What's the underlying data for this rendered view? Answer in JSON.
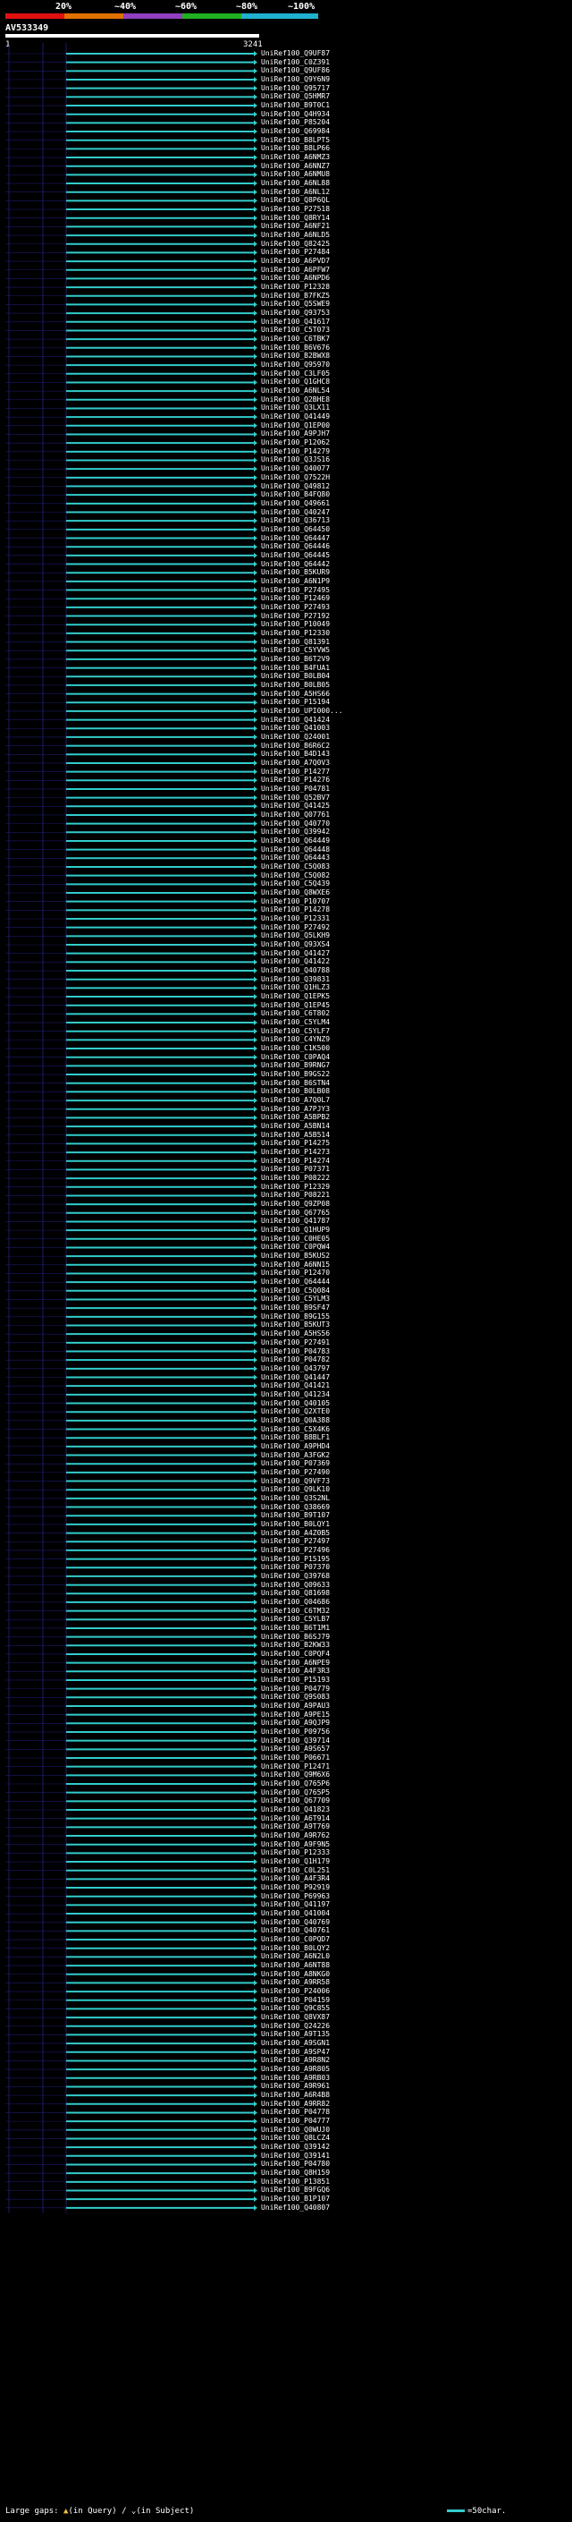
{
  "header": {
    "pct_labels": [
      "20%",
      "~40%",
      "~60%",
      "~80%",
      "~100%"
    ],
    "bar_colors": [
      "#e01010",
      "#e07000",
      "#9040c0",
      "#20b020",
      "#20b0d0"
    ],
    "query_name": "AV533349",
    "scale_start": "1",
    "scale_end": "3241"
  },
  "colors": {
    "hit": "#33cccc",
    "grid": "#1a1a6a",
    "bg": "#000000"
  },
  "hits": [
    "UniRef100_Q9UF87",
    "UniRef100_C0Z391",
    "UniRef100_Q9UF86",
    "UniRef100_Q9Y6N9",
    "UniRef100_Q95717",
    "UniRef100_Q5HMR7",
    "UniRef100_B9T0C1",
    "UniRef100_Q4H934",
    "UniRef100_P85204",
    "UniRef100_Q69984",
    "UniRef100_B8LPT5",
    "UniRef100_B8LP66",
    "UniRef100_A6NMZ3",
    "UniRef100_A6NNZ7",
    "UniRef100_A6NMU8",
    "UniRef100_A6NL88",
    "UniRef100_A6NL12",
    "UniRef100_Q8P6QL",
    "UniRef100_P27518",
    "UniRef100_Q8RY14",
    "UniRef100_A6NF21",
    "UniRef100_A6NLD5",
    "UniRef100_Q82425",
    "UniRef100_P27484",
    "UniRef100_A6PVD7",
    "UniRef100_A6PFW7",
    "UniRef100_A6NPD6",
    "UniRef100_P12328",
    "UniRef100_B7FKZ5",
    "UniRef100_Q5SWE9",
    "UniRef100_Q93753",
    "UniRef100_Q41617",
    "UniRef100_C5T073",
    "UniRef100_C6TBK7",
    "UniRef100_B6V676",
    "UniRef100_B2BWX8",
    "UniRef100_Q95970",
    "UniRef100_C3LF05",
    "UniRef100_Q1GHC8",
    "UniRef100_A6NL54",
    "UniRef100_Q2BHE8",
    "UniRef100_Q3LX11",
    "UniRef100_Q41449",
    "UniRef100_Q1EP00",
    "UniRef100_A9PJH7",
    "UniRef100_P12062",
    "UniRef100_P14279",
    "UniRef100_Q3JS16",
    "UniRef100_Q40077",
    "UniRef100_Q7522H",
    "UniRef100_Q49812",
    "UniRef100_B4FQ80",
    "UniRef100_Q49661",
    "UniRef100_Q40247",
    "UniRef100_Q36713",
    "UniRef100_Q64450",
    "UniRef100_Q64447",
    "UniRef100_Q64446",
    "UniRef100_Q64445",
    "UniRef100_Q64442",
    "UniRef100_B5KUR9",
    "UniRef100_A6N1P9",
    "UniRef100_P27495",
    "UniRef100_P12469",
    "UniRef100_P27493",
    "UniRef100_P27192",
    "UniRef100_P10049",
    "UniRef100_P12330",
    "UniRef100_Q81391",
    "UniRef100_C5YVW5",
    "UniRef100_B6T2V9",
    "UniRef100_B4FUA1",
    "UniRef100_B0LB04",
    "UniRef100_B0LB05",
    "UniRef100_A5HS66",
    "UniRef100_P15194",
    "UniRef100_UPI000...",
    "UniRef100_Q41424",
    "UniRef100_Q41003",
    "UniRef100_Q24001",
    "UniRef100_B6R6C2",
    "UniRef100_B4D143",
    "UniRef100_A7Q0V3",
    "UniRef100_P14277",
    "UniRef100_P14276",
    "UniRef100_P04781",
    "UniRef100_Q52BV7",
    "UniRef100_Q41425",
    "UniRef100_Q07761",
    "UniRef100_Q40770",
    "UniRef100_Q39942",
    "UniRef100_Q64449",
    "UniRef100_Q64448",
    "UniRef100_Q64443",
    "UniRef100_C5Q083",
    "UniRef100_C5Q082",
    "UniRef100_C5Q439",
    "UniRef100_Q8WXE6",
    "UniRef100_P10707",
    "UniRef100_P14278",
    "UniRef100_P12331",
    "UniRef100_P27492",
    "UniRef100_Q5LKH9",
    "UniRef100_Q93XS4",
    "UniRef100_Q41427",
    "UniRef100_Q41422",
    "UniRef100_Q40788",
    "UniRef100_Q39831",
    "UniRef100_Q1HLZ3",
    "UniRef100_Q1EPK5",
    "UniRef100_Q1EP45",
    "UniRef100_C6T802",
    "UniRef100_C5YLM4",
    "UniRef100_C5YLF7",
    "UniRef100_C4YNZ9",
    "UniRef100_C1K500",
    "UniRef100_C0PAQ4",
    "UniRef100_B9RNG7",
    "UniRef100_B9GS22",
    "UniRef100_B6STN4",
    "UniRef100_B0LB08",
    "UniRef100_A7Q0L7",
    "UniRef100_A7PJY3",
    "UniRef100_A5BPB2",
    "UniRef100_A5BN14",
    "UniRef100_A5B514",
    "UniRef100_P14275",
    "UniRef100_P14273",
    "UniRef100_P14274",
    "UniRef100_P07371",
    "UniRef100_P08222",
    "UniRef100_P12329",
    "UniRef100_P08221",
    "UniRef100_Q9ZP08",
    "UniRef100_Q67765",
    "UniRef100_Q41787",
    "UniRef100_Q1HUP9",
    "UniRef100_C0HE05",
    "UniRef100_C0PQW4",
    "UniRef100_B5KUS2",
    "UniRef100_A6NN15",
    "UniRef100_P12470",
    "UniRef100_Q64444",
    "UniRef100_C5Q084",
    "UniRef100_C5YLM3",
    "UniRef100_B9SF47",
    "UniRef100_B9G155",
    "UniRef100_B5KUT3",
    "UniRef100_A5HS56",
    "UniRef100_P27491",
    "UniRef100_P04783",
    "UniRef100_P04782",
    "UniRef100_Q43797",
    "UniRef100_Q41447",
    "UniRef100_Q41421",
    "UniRef100_Q41234",
    "UniRef100_Q40105",
    "UniRef100_Q2XTE0",
    "UniRef100_Q0A388",
    "UniRef100_C5X4K6",
    "UniRef100_B8BLF1",
    "UniRef100_A9PHD4",
    "UniRef100_A3FGK2",
    "UniRef100_P07369",
    "UniRef100_P27490",
    "UniRef100_Q9VF73",
    "UniRef100_Q9LK10",
    "UniRef100_Q3S2NL",
    "UniRef100_Q38669",
    "UniRef100_B9T107",
    "UniRef100_B0LQY1",
    "UniRef100_A4Z0B5",
    "UniRef100_P27497",
    "UniRef100_P27496",
    "UniRef100_P15195",
    "UniRef100_P07370",
    "UniRef100_Q39768",
    "UniRef100_Q09633",
    "UniRef100_Q81698",
    "UniRef100_Q04686",
    "UniRef100_C6TM32",
    "UniRef100_C5YLB7",
    "UniRef100_B6T1M1",
    "UniRef100_B6SJ79",
    "UniRef100_B2KW33",
    "UniRef100_C0PQF4",
    "UniRef100_A6NPE9",
    "UniRef100_A4F3R3",
    "UniRef100_P15193",
    "UniRef100_P04779",
    "UniRef100_Q9S083",
    "UniRef100_A9PAU3",
    "UniRef100_A9PE15",
    "UniRef100_A9QJP9",
    "UniRef100_P09756",
    "UniRef100_Q39714",
    "UniRef100_A9S657",
    "UniRef100_P06671",
    "UniRef100_P12471",
    "UniRef100_Q9M6X6",
    "UniRef100_Q765P6",
    "UniRef100_Q765P5",
    "UniRef100_Q67709",
    "UniRef100_Q41823",
    "UniRef100_A6T914",
    "UniRef100_A9T769",
    "UniRef100_A9R762",
    "UniRef100_A9F9N5",
    "UniRef100_P12333",
    "UniRef100_Q1H179",
    "UniRef100_C0L251",
    "UniRef100_A4F3R4",
    "UniRef100_P92919",
    "UniRef100_P69963",
    "UniRef100_Q41197",
    "UniRef100_Q41004",
    "UniRef100_Q40769",
    "UniRef100_Q40761",
    "UniRef100_C0PQD7",
    "UniRef100_B0LQY2",
    "UniRef100_A6N2L0",
    "UniRef100_A6NT88",
    "UniRef100_A8NKG0",
    "UniRef100_A9RR58",
    "UniRef100_P24006",
    "UniRef100_P04159",
    "UniRef100_Q9C855",
    "UniRef100_Q8VX87",
    "UniRef100_Q24226",
    "UniRef100_A9T135",
    "UniRef100_A9SGN1",
    "UniRef100_A9SP47",
    "UniRef100_A9R8N2",
    "UniRef100_A9R805",
    "UniRef100_A9RB03",
    "UniRef100_A9R961",
    "UniRef100_A6R4B8",
    "UniRef100_A9RR82",
    "UniRef100_P04778",
    "UniRef100_P04777",
    "UniRef100_Q0WUJ0",
    "UniRef100_Q8LCZ4",
    "UniRef100_Q39142",
    "UniRef100_Q39141",
    "UniRef100_P04780",
    "UniRef100_Q8H159",
    "UniRef100_P13851",
    "UniRef100_B9FGQ6",
    "UniRef100_B1P107",
    "UniRef100_Q40807"
  ],
  "footer": {
    "large_gaps_label": "Large gaps:",
    "in_query_label": "(in Query)",
    "separator": "/",
    "in_subject_label": "(in Subject)",
    "key_label": "=50char."
  }
}
